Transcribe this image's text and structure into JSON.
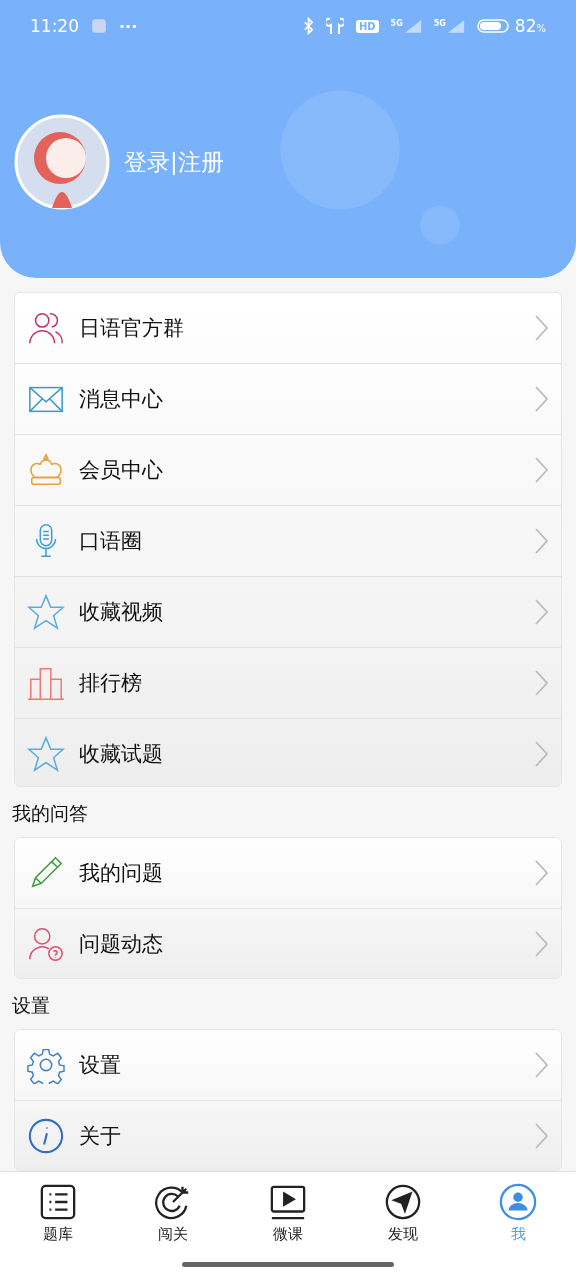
{
  "status_bar": {
    "time": "11:20",
    "more": "···",
    "hd_label": "HD",
    "network_labels": [
      "5G",
      "5G"
    ],
    "battery_percent": "82",
    "percent_sign": "%"
  },
  "profile": {
    "login_text": "登录|注册"
  },
  "sections": [
    {
      "items": [
        {
          "label": "日语官方群",
          "kind": "group"
        },
        {
          "label": "消息中心",
          "kind": "mail"
        },
        {
          "label": "会员中心",
          "kind": "crown"
        },
        {
          "label": "口语圈",
          "kind": "mic"
        },
        {
          "label": "收藏视频",
          "kind": "star"
        },
        {
          "label": "排行榜",
          "kind": "chart"
        },
        {
          "label": "收藏试题",
          "kind": "star"
        }
      ]
    },
    {
      "title": "我的问答",
      "items": [
        {
          "label": "我的问题",
          "kind": "pencil"
        },
        {
          "label": "问题动态",
          "kind": "user-question"
        }
      ]
    },
    {
      "title": "设置",
      "items": [
        {
          "label": "设置",
          "kind": "gear"
        },
        {
          "label": "关于",
          "kind": "info"
        }
      ]
    }
  ],
  "tab_bar": [
    {
      "label": "题库",
      "kind": "list",
      "selected": false
    },
    {
      "label": "闯关",
      "kind": "target",
      "selected": false
    },
    {
      "label": "微课",
      "kind": "video",
      "selected": false
    },
    {
      "label": "发现",
      "kind": "compass",
      "selected": false
    },
    {
      "label": "我",
      "kind": "user",
      "selected": true
    }
  ]
}
